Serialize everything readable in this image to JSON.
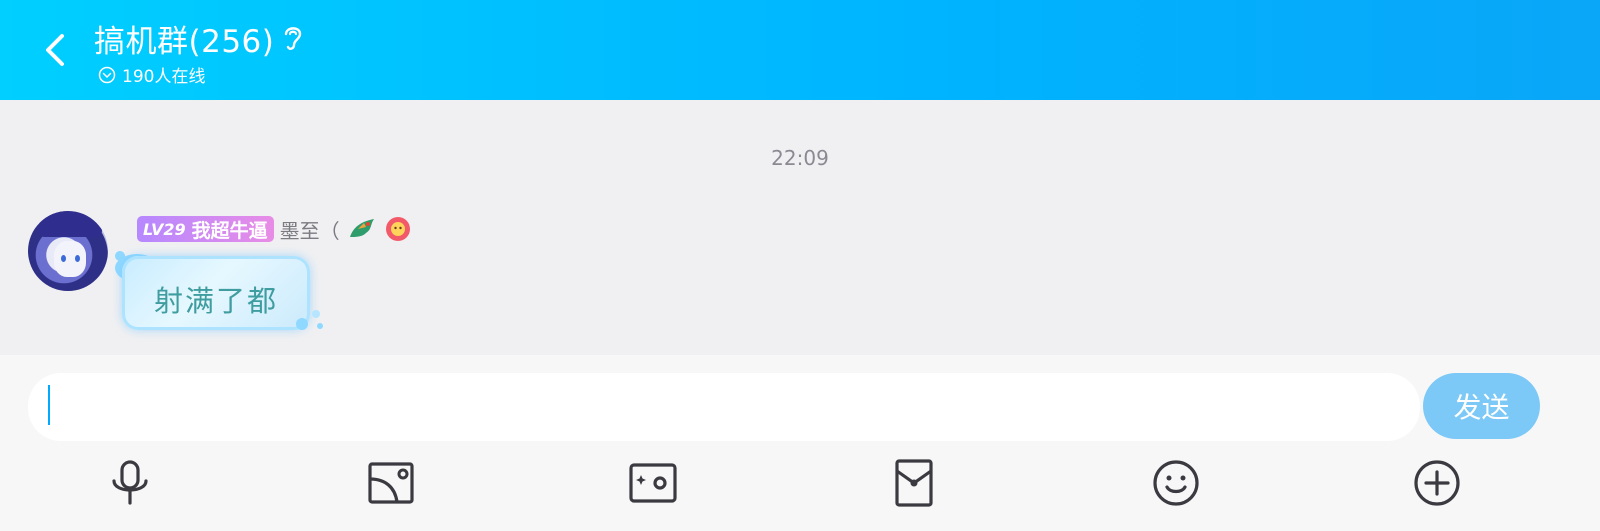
{
  "header": {
    "title": "搞机群(256)",
    "online": "190人在线",
    "back_icon": "chevron-left-icon",
    "mode_icon": "ear-icon"
  },
  "chat": {
    "timestamp": "22:09",
    "messages": [
      {
        "level": "LV29",
        "member_title": "我超牛逼",
        "nickname": "墨至（",
        "text": "射满了都"
      }
    ]
  },
  "composer": {
    "input_value": "",
    "send_label": "发送",
    "tools": [
      "microphone-icon",
      "image-icon",
      "camera-icon",
      "red-packet-icon",
      "emoji-icon",
      "plus-icon"
    ]
  },
  "colors": {
    "header_start": "#00cfff",
    "header_end": "#0aa6f8",
    "send_button": "#7cc8f6",
    "level_badge": "#b688ff",
    "bubble_text": "#3f9da0"
  }
}
